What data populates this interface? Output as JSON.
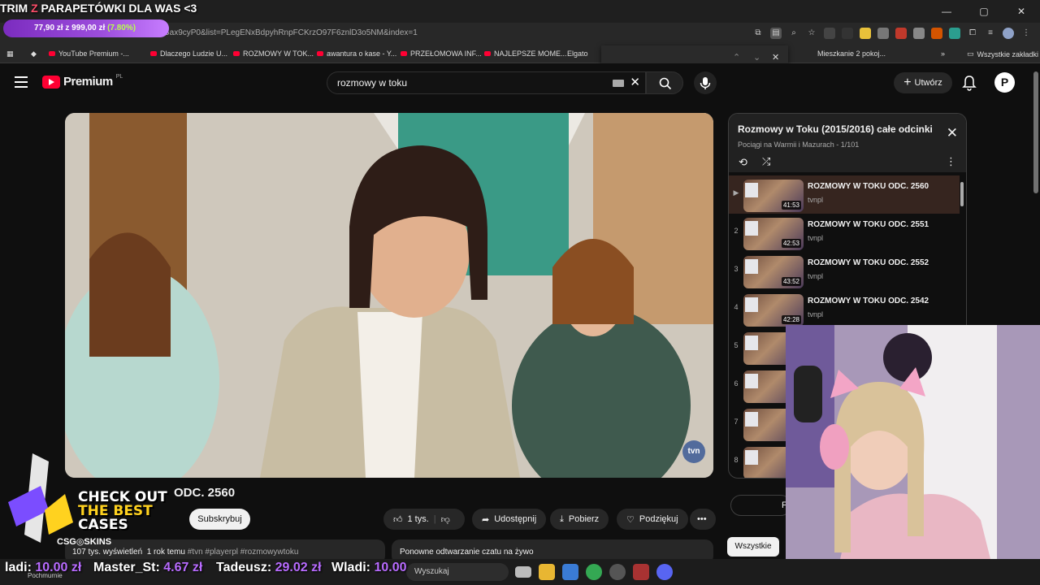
{
  "overlay": {
    "title_a": "TRIM ",
    "title_z": "Z",
    "title_b": " PARAPETÓWKI DLA WAS <3",
    "goal_amount": "77,90 zł z 999,00 zł",
    "goal_pct": "(7.80%)"
  },
  "browser": {
    "url": "n?v=G_eGax9cyP0&list=PLegENxBdpyhRnpFCKrzO97F6znlD3o5NM&index=1",
    "bookmarks": [
      "YouTube Premium -...",
      "Dlaczego Ludzie U...",
      "ROZMOWY W TOK...",
      "awantura o kase - Y...",
      "PRZEŁOMOWA INF...",
      "NAJLEPSZE MOME...",
      "Elgato",
      "Mieszkanie 2 pokoj...",
      "Wszystkie zakładki"
    ]
  },
  "header": {
    "logo": "Premium",
    "region": "PL",
    "search_value": "rozmowy w toku",
    "create_label": "Utwórz",
    "avatar_letter": "P"
  },
  "video": {
    "title": "ODC. 2560",
    "subscribe": "Subskrybuj",
    "likes": "1 tys.",
    "share": "Udostępnij",
    "download": "Pobierz",
    "thanks": "Podziękuj",
    "views": "107 tys. wyświetleń",
    "age": "1 rok temu",
    "tags": "#tvn #playerpl #rozmowywtoku",
    "replay": "Ponowne odtwarzanie czatu na żywo",
    "chip_all": "Wszystkie",
    "watermark": "tvn"
  },
  "playlist": {
    "title": "Rozmowy w Toku (2015/2016) całe odcinki",
    "subtitle": "Pociągi na Warmii i Mazurach - 1/101",
    "items": [
      {
        "idx": "▶",
        "title": "ROZMOWY W TOKU ODC. 2560",
        "channel": "tvnpl",
        "duration": "41:53"
      },
      {
        "idx": "2",
        "title": "ROZMOWY W TOKU ODC. 2551",
        "channel": "tvnpl",
        "duration": "42:53"
      },
      {
        "idx": "3",
        "title": "ROZMOWY W TOKU ODC. 2552",
        "channel": "tvnpl",
        "duration": "43:52"
      },
      {
        "idx": "4",
        "title": "ROZMOWY W TOKU ODC. 2542",
        "channel": "tvnpl",
        "duration": "42:28"
      },
      {
        "idx": "5",
        "title": "",
        "channel": "",
        "duration": "43"
      },
      {
        "idx": "6",
        "title": "",
        "channel": "",
        "duration": "43"
      },
      {
        "idx": "7",
        "title": "",
        "channel": "",
        "duration": "43"
      },
      {
        "idx": "8",
        "title": "",
        "channel": "",
        "duration": "42"
      }
    ]
  },
  "ad": {
    "line1": "CHECK OUT",
    "line2": "THE BEST",
    "line3": "CASES",
    "brand": "CSG◎SKINS"
  },
  "ticker": [
    {
      "name": "ladi:",
      "amount": "10.00 zł"
    },
    {
      "name": "Master_St:",
      "amount": "4.67 zł"
    },
    {
      "name": "Tadeusz:",
      "amount": "29.02 zł"
    },
    {
      "name": "Wladi:",
      "amount": "10.00"
    }
  ],
  "taskbar": {
    "search": "Wyszukaj",
    "weather": "Pochmurnie"
  }
}
